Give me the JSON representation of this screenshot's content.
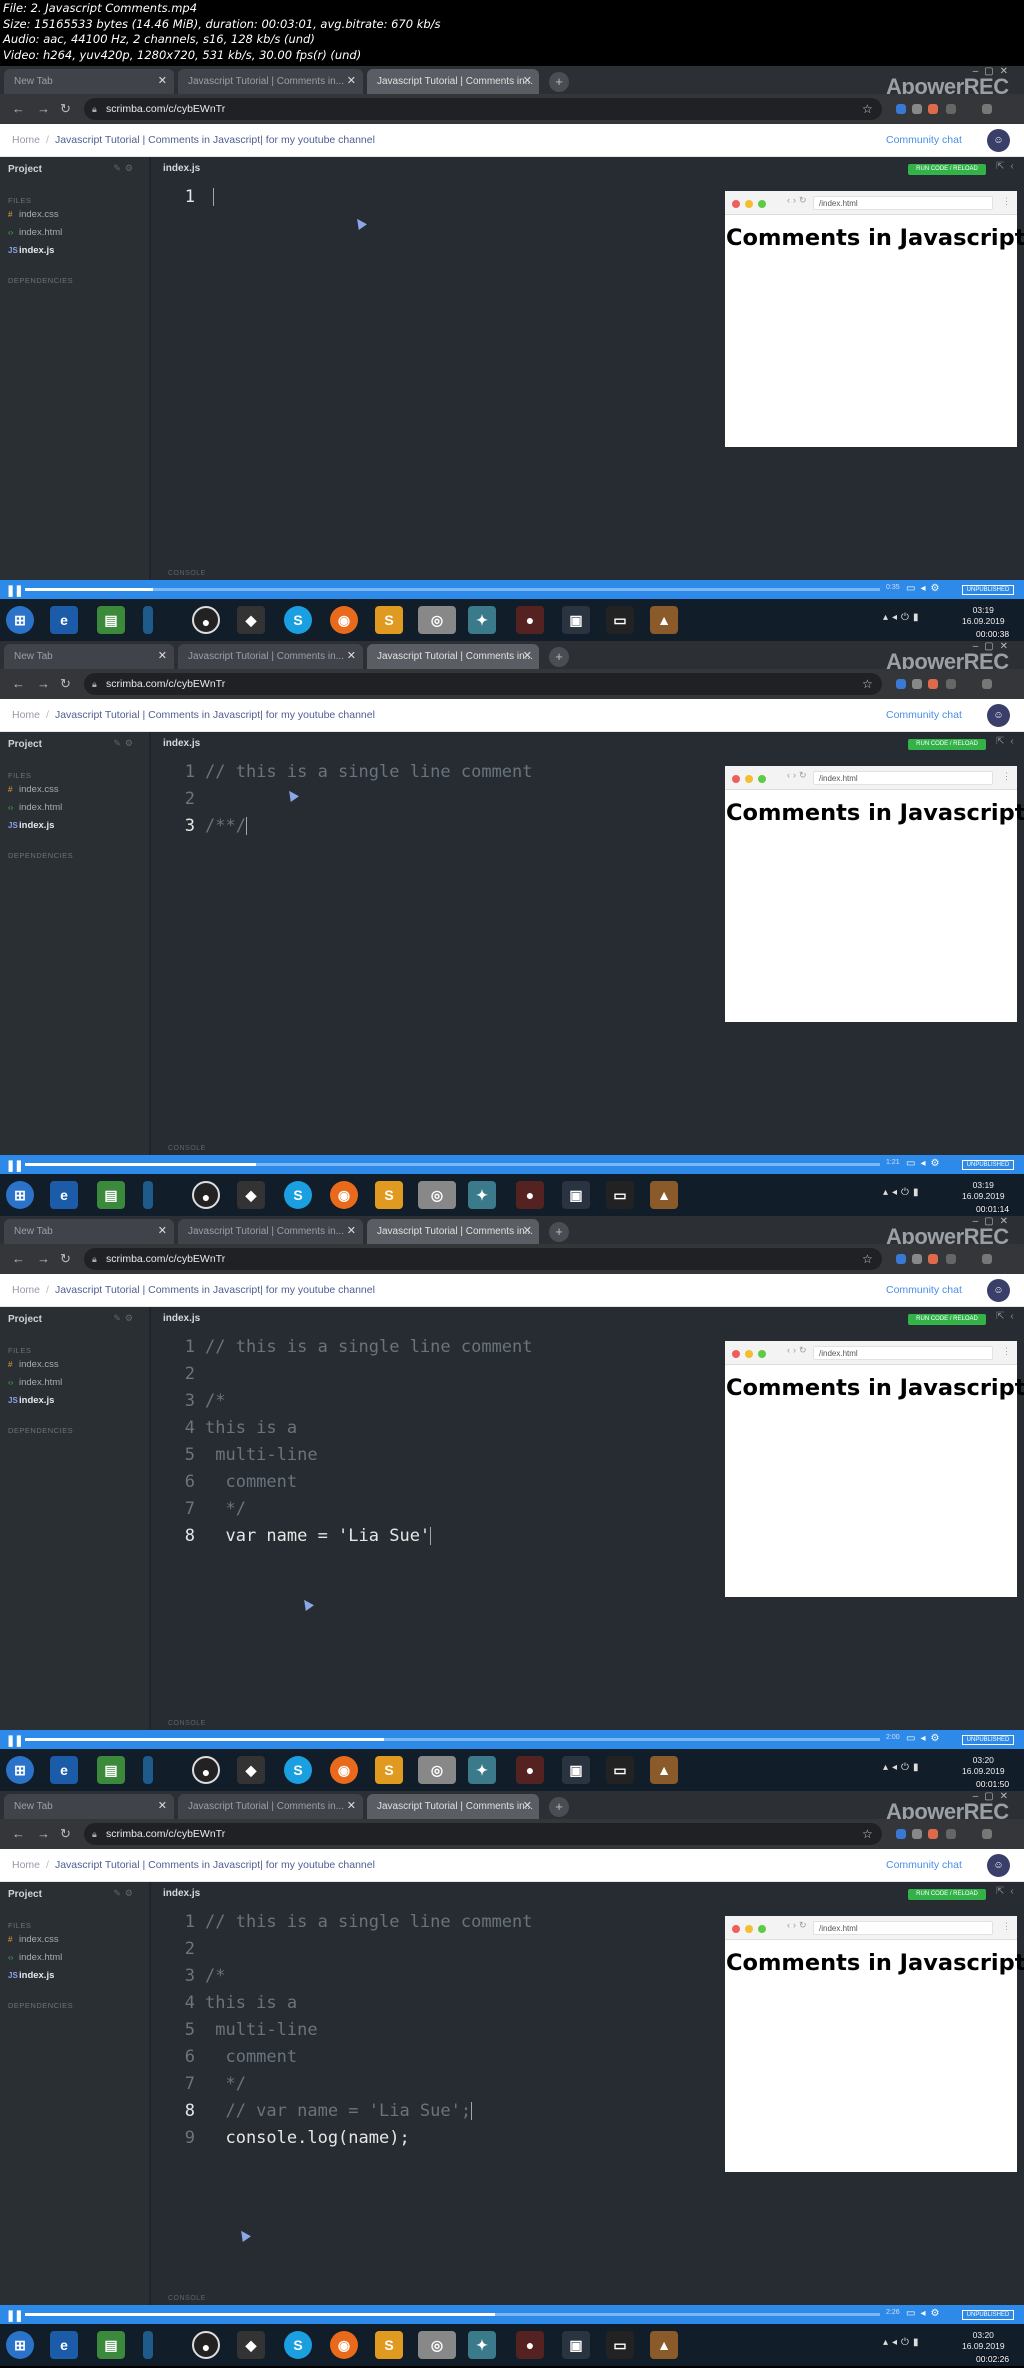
{
  "header": {
    "lines": [
      "File: 2. Javascript Comments.mp4",
      "Size: 15165533 bytes (14.46 MiB), duration: 00:03:01, avg.bitrate: 670 kb/s",
      "Audio: aac, 44100 Hz, 2 channels, s16, 128 kb/s (und)",
      "Video: h264, yuv420p, 1280x720, 531 kb/s, 30.00 fps(r) (und)"
    ]
  },
  "browser": {
    "tabs": [
      "New Tab",
      "Javascript Tutorial | Comments in...",
      "Javascript Tutorial | Comments in..."
    ],
    "url": "scrimba.com/c/cybEWnTr",
    "watermark": "ApowerREC"
  },
  "scrimba": {
    "breadcrumb_home": "Home",
    "breadcrumb_title": "Javascript Tutorial | Comments in Javascript| for my youtube channel",
    "community_chat": "Community chat",
    "project_label": "Project",
    "files_label": "FILES",
    "files": [
      "index.css",
      "index.html",
      "index.js"
    ],
    "dependencies_label": "DEPENDENCIES",
    "editor_filename": "index.js",
    "run_label": "RUN CODE / RELOAD",
    "console_label": "CONSOLE",
    "preview_url": "/index.html",
    "preview_heading": "Comments in Javascript",
    "unpublished_label": "UNPUBLISHED"
  },
  "frames": [
    {
      "progress": 0.15,
      "player_time": "0:35",
      "clock_time": "03:19",
      "clock_date": "16.09.2019",
      "video_timestamp": "00:00:38",
      "lines": []
    },
    {
      "progress": 0.27,
      "player_time": "1:21",
      "clock_time": "03:19",
      "clock_date": "16.09.2019",
      "video_timestamp": "00:01:14",
      "lines": [
        {
          "n": "1",
          "text": "// this is a single line comment",
          "kind": "comment"
        },
        {
          "n": "2",
          "text": "",
          "kind": "comment"
        },
        {
          "n": "3",
          "text": "/**/",
          "kind": "comment"
        }
      ]
    },
    {
      "progress": 0.42,
      "player_time": "2:00",
      "clock_time": "03:20",
      "clock_date": "16.09.2019",
      "video_timestamp": "00:01:50",
      "lines": [
        {
          "n": "1",
          "text": "// this is a single line comment",
          "kind": "comment"
        },
        {
          "n": "2",
          "text": "",
          "kind": "comment"
        },
        {
          "n": "3",
          "text": "/*",
          "kind": "comment"
        },
        {
          "n": "4",
          "text": "this is a",
          "kind": "comment"
        },
        {
          "n": "5",
          "text": " multi-line",
          "kind": "comment"
        },
        {
          "n": "6",
          "text": "  comment",
          "kind": "comment"
        },
        {
          "n": "7",
          "text": "  */",
          "kind": "comment"
        },
        {
          "n": "8",
          "text": "  var name = 'Lia Sue'",
          "kind": "code"
        }
      ]
    },
    {
      "progress": 0.55,
      "player_time": "2:26",
      "clock_time": "03:20",
      "clock_date": "16.09.2019",
      "video_timestamp": "00:02:26",
      "lines": [
        {
          "n": "1",
          "text": "// this is a single line comment",
          "kind": "comment"
        },
        {
          "n": "2",
          "text": "",
          "kind": "comment"
        },
        {
          "n": "3",
          "text": "/*",
          "kind": "comment"
        },
        {
          "n": "4",
          "text": "this is a",
          "kind": "comment"
        },
        {
          "n": "5",
          "text": " multi-line",
          "kind": "comment"
        },
        {
          "n": "6",
          "text": "  comment",
          "kind": "comment"
        },
        {
          "n": "7",
          "text": "  */",
          "kind": "comment"
        },
        {
          "n": "8",
          "text": "  // var name = 'Lia Sue';",
          "kind": "comment"
        },
        {
          "n": "9",
          "text": "  console.log(name);",
          "kind": "code"
        }
      ]
    }
  ]
}
